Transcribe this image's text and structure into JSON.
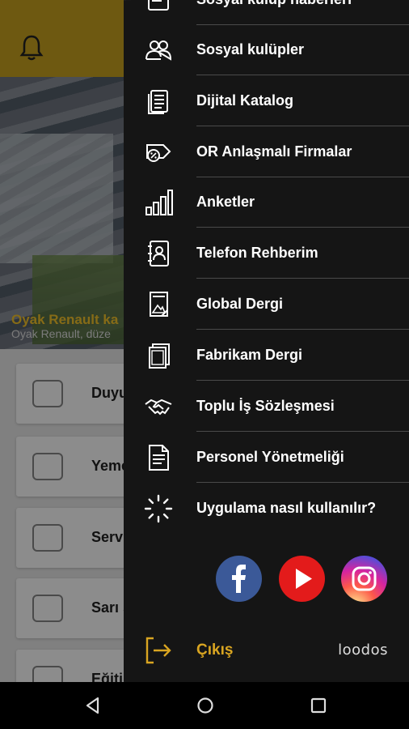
{
  "background": {
    "hero_caption": "Oyak Renault ka",
    "hero_subtitle": "Oyak Renault, düze",
    "cards": [
      {
        "label": "Duyurular",
        "icon": "megaphone-icon"
      },
      {
        "label": "Yemek Listesi",
        "icon": "chef-icon"
      },
      {
        "label": "Servis listesi",
        "icon": "bus-icon"
      },
      {
        "label": "Sarı sayfalar",
        "icon": "people-icon"
      },
      {
        "label": "Eğitim Duyuruları",
        "icon": "book-icon"
      }
    ]
  },
  "menu": {
    "items": [
      {
        "label": "Sosyal kulüp haberleri",
        "icon": "news-icon"
      },
      {
        "label": "Sosyal kulüpler",
        "icon": "group-icon"
      },
      {
        "label": "Dijital Katalog",
        "icon": "document-icon"
      },
      {
        "label": "OR Anlaşmalı Firmalar",
        "icon": "discount-tag-icon"
      },
      {
        "label": "Anketler",
        "icon": "bar-chart-icon"
      },
      {
        "label": "Telefon Rehberim",
        "icon": "phonebook-icon"
      },
      {
        "label": "Global Dergi",
        "icon": "magazine-icon"
      },
      {
        "label": "Fabrikam Dergi",
        "icon": "magazine-stack-icon"
      },
      {
        "label": "Toplu İş Sözleşmesi",
        "icon": "handshake-icon"
      },
      {
        "label": "Personel Yönetmeliği",
        "icon": "regulation-document-icon"
      },
      {
        "label": "Uygulama nasıl kullanılır?",
        "icon": "loading-spinner-icon"
      }
    ],
    "social": [
      {
        "name": "facebook-icon",
        "color": "#3b5998"
      },
      {
        "name": "youtube-icon",
        "color": "#e31b1b"
      },
      {
        "name": "instagram-icon",
        "color": "#d6249f"
      }
    ],
    "logout_label": "Çıkış",
    "brand": "loodos"
  },
  "colors": {
    "accent": "#d9a521",
    "header": "#c9a21f",
    "drawer": "#151515"
  }
}
